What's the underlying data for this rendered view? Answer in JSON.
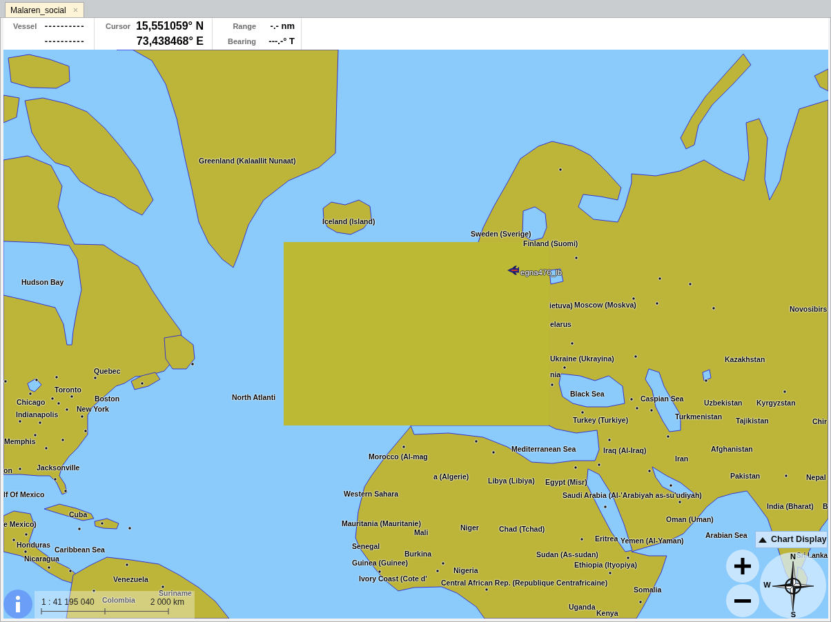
{
  "tabs": [
    {
      "label": "Malaren_social",
      "selected": true
    }
  ],
  "info_bar": {
    "vessel": {
      "label": "Vessel",
      "lines": [
        "----------",
        "----------"
      ]
    },
    "cursor": {
      "label": "Cursor",
      "lines": [
        "15,551059° N",
        "73,438468° E"
      ]
    },
    "range": {
      "label": "Range",
      "value": "-.- nm"
    },
    "bearing": {
      "label": "Bearing",
      "value": "---.-° T"
    }
  },
  "map": {
    "labels": [
      "Greenland (Kalaallit Nunaat)",
      "Iceland (Island)",
      "Sweden (Sverige)",
      "Finland (Suomi)",
      "Hudson Bay",
      "ietuva)",
      "Moscow (Moskva)",
      "Novosibirs",
      "elarus",
      "Ukraine (Ukrayina)",
      "Kazakhstan",
      "Quebec",
      "nia",
      "Toronto",
      "Chicago",
      "Boston",
      "North Atlanti",
      "Black Sea",
      "Caspian Sea",
      "Uzbekistan",
      "Kyrgyzstan",
      "New York",
      "Indianapolis",
      "Turkey (Turkiye)",
      "Turkmenistan",
      "Tajikistan",
      "Chir",
      "Memphis",
      "Mediterranean Sea",
      "Iraq (Al-Iraq)",
      "Afghanistan",
      "Morocco (Al-mag",
      "Iran",
      "on",
      "Jacksonville",
      "a (Algerie)",
      "Libya (Libiya)",
      "Egypt (Misr)",
      "Pakistan",
      "Nepal",
      "lf Of Mexico",
      "Western Sahara",
      "Saudi Arabia (Al-'Arabiyah as-su'udiyah)",
      "India (Bharat)",
      "B",
      "Cuba",
      "e Mexico)",
      "Mauritania (Mauritanie)",
      "Oman (Uman)",
      "Mali",
      "Niger",
      "Chad (Tchad)",
      "Honduras",
      "Caribbean Sea",
      "Senegal",
      "Eritrea",
      "Yemen (Al-Yaman)",
      "Arabian Sea",
      "Nicaragua",
      "Burkina",
      "Sudan (As-sudan)",
      "Sri Lanka",
      "Guinea (Guinee)",
      "Ethiopia (Ityopiya)",
      "Nigeria",
      "Venezuela",
      "Ivory Coast (Cote d'",
      "Central African Rep. (Republique Centrafricaine)",
      "Suriname",
      "Somalia",
      "Colombia",
      "Uganda",
      "Kenya"
    ],
    "vessel": {
      "name": "egna476_lb"
    },
    "scale": {
      "ratio": "1 : 41 195 040",
      "distance": "2 000 km"
    },
    "chart_display_button": {
      "label": "Chart Display"
    },
    "compass": {
      "north": "N",
      "west": "W",
      "south": "S"
    }
  }
}
